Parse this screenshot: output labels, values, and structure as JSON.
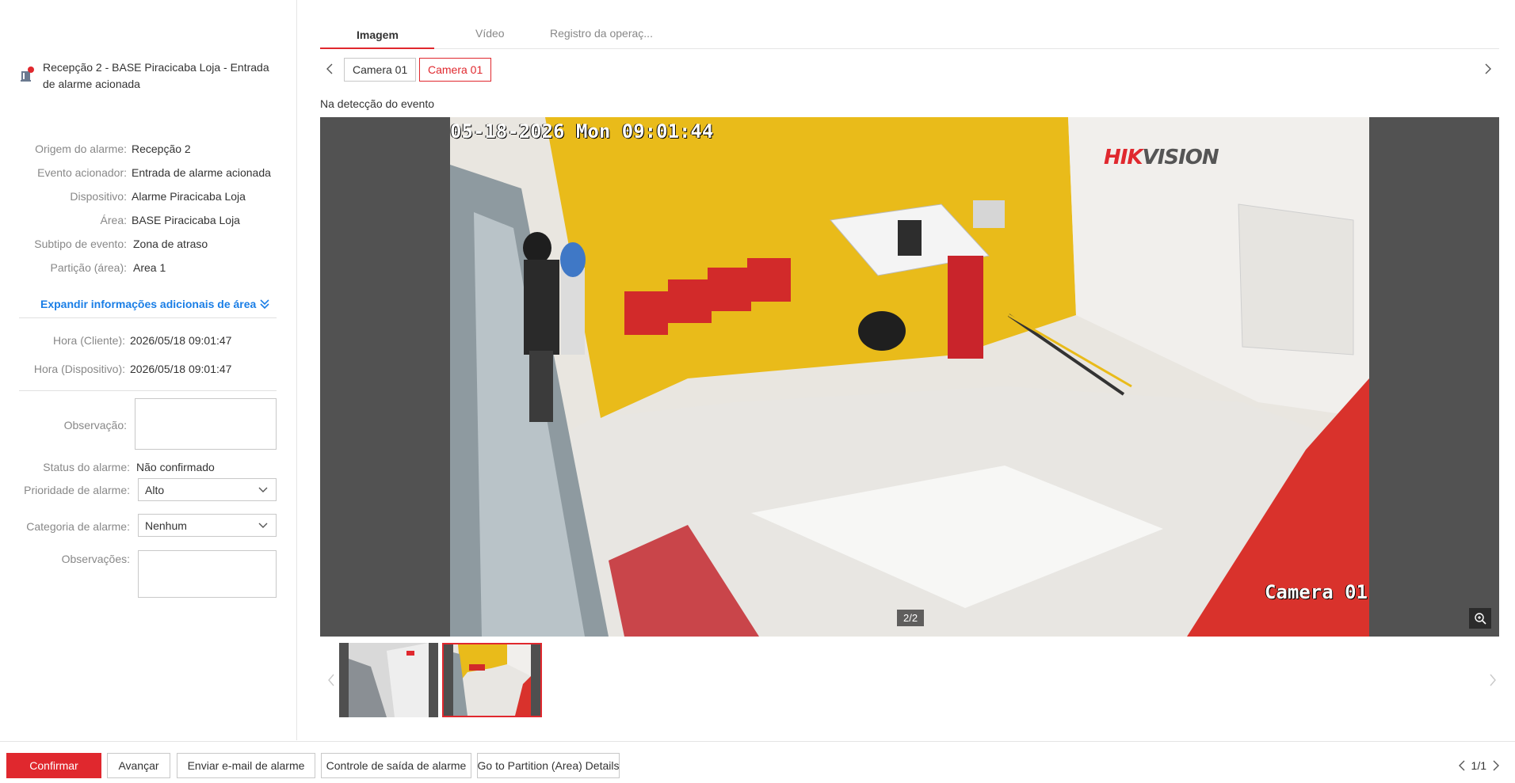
{
  "alarm": {
    "title": "Recepção 2 - BASE Piracicaba Loja - Entrada de alarme acionada"
  },
  "details": [
    {
      "label": "Origem do alarme:",
      "value": "Recepção 2"
    },
    {
      "label": "Evento acionador:",
      "value": "Entrada de alarme acionada"
    },
    {
      "label": "Dispositivo:",
      "value": "Alarme Piracicaba Loja"
    },
    {
      "label": "Área:",
      "value": "BASE Piracicaba Loja"
    },
    {
      "label": "Subtipo de evento:",
      "value": "Zona de atraso"
    },
    {
      "label": "Partição (área):",
      "value": "Area 1"
    }
  ],
  "expand_link": "Expandir informações adicionais de área",
  "times": [
    {
      "label": "Hora (Cliente):",
      "value": "2026/05/18 09:01:47"
    },
    {
      "label": "Hora (Dispositivo):",
      "value": "2026/05/18 09:01:47"
    }
  ],
  "form": {
    "observacao_label": "Observação:",
    "status_label": "Status do alarme:",
    "status_value": "Não confirmado",
    "prioridade_label": "Prioridade de alarme:",
    "prioridade_value": "Alto",
    "categoria_label": "Categoria de alarme:",
    "categoria_value": "Nenhum",
    "observacoes_label": "Observações:"
  },
  "tabs": [
    "Imagem",
    "Vídeo",
    "Registro da operaç..."
  ],
  "active_tab": 0,
  "cameras": [
    "Camera 01",
    "Camera 01"
  ],
  "active_camera": 1,
  "event_label": "Na detecção do evento",
  "snapshot": {
    "osd_time": "05-18-2026 Mon 09:01:44",
    "brand_red": "HIK",
    "brand_gray": "VISION",
    "osd_camera": "Camera 01",
    "page_indicator": "2/2"
  },
  "footer": {
    "confirm": "Confirmar",
    "advance": "Avançar",
    "email": "Enviar e-mail de alarme",
    "output": "Controle de saída de alarme",
    "partition": "Go to Partition (Area) Details",
    "pager": "1/1"
  },
  "colors": {
    "accent": "#e0282e",
    "link": "#1a7ee6"
  }
}
